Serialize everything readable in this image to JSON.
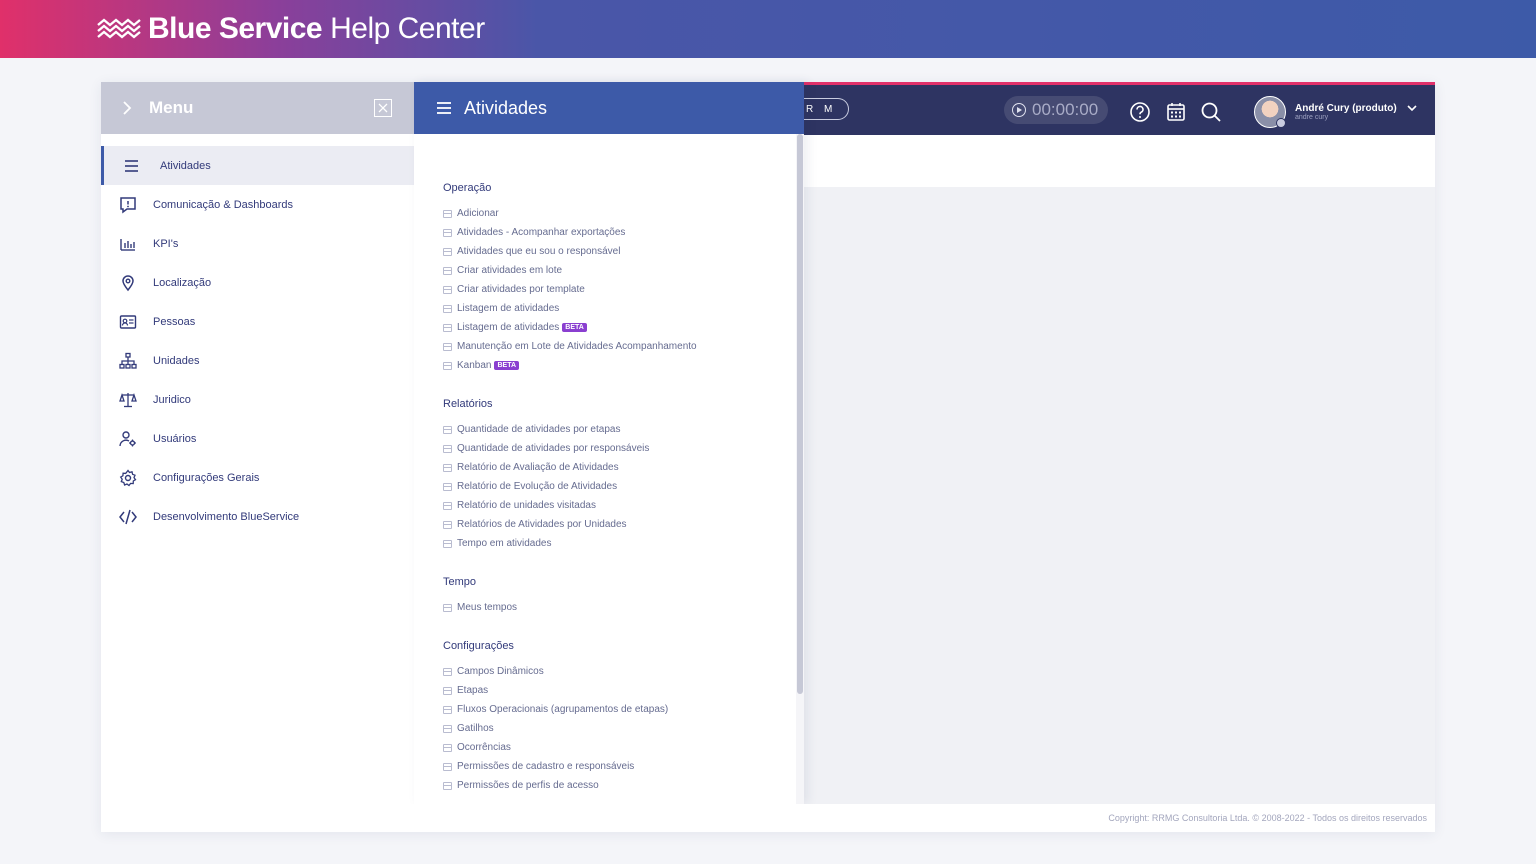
{
  "header": {
    "brand": "Blue Service",
    "subtitle": "Help Center"
  },
  "topbar": {
    "pill_text": "R M",
    "timer": "00:00:00",
    "user_name": "André Cury (produto)",
    "user_login": "andre cury"
  },
  "menu": {
    "title": "Menu",
    "items": [
      {
        "label": "Atividades",
        "icon": "list-icon"
      },
      {
        "label": "Comunicação & Dashboards",
        "icon": "message-alert-icon"
      },
      {
        "label": "KPI's",
        "icon": "bar-chart-icon"
      },
      {
        "label": "Localização",
        "icon": "map-pin-icon"
      },
      {
        "label": "Pessoas",
        "icon": "id-card-icon"
      },
      {
        "label": "Unidades",
        "icon": "org-chart-icon"
      },
      {
        "label": "Juridico",
        "icon": "scales-icon"
      },
      {
        "label": "Usuários",
        "icon": "user-gear-icon"
      },
      {
        "label": "Configurações Gerais",
        "icon": "gear-icon"
      },
      {
        "label": "Desenvolvimento BlueService",
        "icon": "code-icon"
      }
    ]
  },
  "panel": {
    "title": "Atividades",
    "sections": [
      {
        "title": "Operação",
        "items": [
          {
            "label": "Adicionar"
          },
          {
            "label": "Atividades - Acompanhar exportações"
          },
          {
            "label": "Atividades que eu sou o responsável"
          },
          {
            "label": "Criar atividades em lote"
          },
          {
            "label": "Criar atividades por template"
          },
          {
            "label": "Listagem de atividades"
          },
          {
            "label": "Listagem de atividades",
            "badge": "BETA"
          },
          {
            "label": "Manutenção em Lote de Atividades Acompanhamento"
          },
          {
            "label": "Kanban",
            "badge": "BETA"
          }
        ]
      },
      {
        "title": "Relatórios",
        "items": [
          {
            "label": "Quantidade de atividades por etapas"
          },
          {
            "label": "Quantidade de atividades por responsáveis"
          },
          {
            "label": "Relatório de Avaliação de Atividades"
          },
          {
            "label": "Relatório de Evolução de Atividades"
          },
          {
            "label": "Relatório de unidades visitadas"
          },
          {
            "label": "Relatórios de Atividades por Unidades"
          },
          {
            "label": "Tempo em atividades"
          }
        ]
      },
      {
        "title": "Tempo",
        "items": [
          {
            "label": "Meus tempos"
          }
        ]
      },
      {
        "title": "Configurações",
        "items": [
          {
            "label": "Campos Dinâmicos"
          },
          {
            "label": "Etapas"
          },
          {
            "label": "Fluxos Operacionais (agrupamentos de etapas)"
          },
          {
            "label": "Gatilhos"
          },
          {
            "label": "Ocorrências"
          },
          {
            "label": "Permissões de cadastro e responsáveis"
          },
          {
            "label": "Permissões de perfis de acesso"
          }
        ]
      }
    ]
  },
  "footer": {
    "copyright": "Copyright: RRMG Consultoria Ltda. © 2008-2022 - Todos os direitos reservados"
  }
}
